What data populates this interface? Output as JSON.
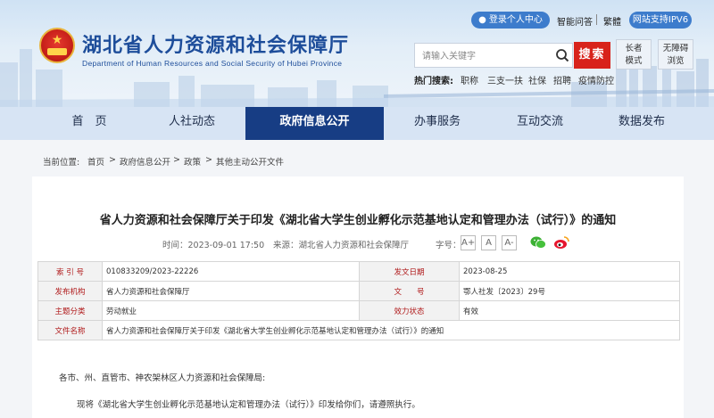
{
  "header": {
    "title": "湖北省人力资源和社会保障厅",
    "subtitle": "Department of Human Resources and Social Security of Hubei Province",
    "login_label": "登录个人中心",
    "links": [
      "智能问答",
      "繁體"
    ],
    "ipv6_label": "网站支持IPV6",
    "search": {
      "placeholder": "请输入关键字",
      "button": "搜索"
    },
    "elder_mode": "长者\n模式",
    "accessible": "无障碍\n浏览",
    "hot_label": "热门搜索:",
    "hot_items": [
      "职称",
      "三支一扶",
      "社保",
      "招聘",
      "疫情防控"
    ]
  },
  "nav": {
    "items": [
      "首　页",
      "人社动态",
      "政府信息公开",
      "办事服务",
      "互动交流",
      "数据发布"
    ],
    "active_index": 2
  },
  "breadcrumb": {
    "label": "当前位置:",
    "items": [
      "首页",
      "政府信息公开",
      "政策",
      "其他主动公开文件"
    ],
    "separator": ">"
  },
  "article": {
    "title": "省人力资源和社会保障厅关于印发《湖北省大学生创业孵化示范基地认定和管理办法（试行）》的通知",
    "time": "时间：2023-09-01 17:50",
    "source": "来源：湖北省人力资源和社会保障厅",
    "font_label": "字号：",
    "font_sizes": [
      "A+",
      "A",
      "A-"
    ],
    "info": {
      "index_label": "索 引 号",
      "index_value": "010833209/2023-22226",
      "date_label": "发文日期",
      "date_value": "2023-08-25",
      "org_label": "发布机构",
      "org_value": "省人力资源和社会保障厅",
      "docno_label": "文　　号",
      "docno_value": "鄂人社发〔2023〕29号",
      "topic_label": "主题分类",
      "topic_value": "劳动就业",
      "status_label": "效力状态",
      "status_value": "有效",
      "name_label": "文件名称",
      "name_value": "省人力资源和社会保障厅关于印发《湖北省大学生创业孵化示范基地认定和管理办法（试行）》的通知"
    },
    "recipients": "各市、州、直管市、神农架林区人力资源和社会保障局:",
    "body": "现将《湖北省大学生创业孵化示范基地认定和管理办法（试行）》印发给你们，请遵照执行。"
  },
  "colors": {
    "nav_active": "#173d84",
    "search_button": "#d8231b",
    "header_blue": "#1d4d9a",
    "label_red": "#b0191a"
  }
}
